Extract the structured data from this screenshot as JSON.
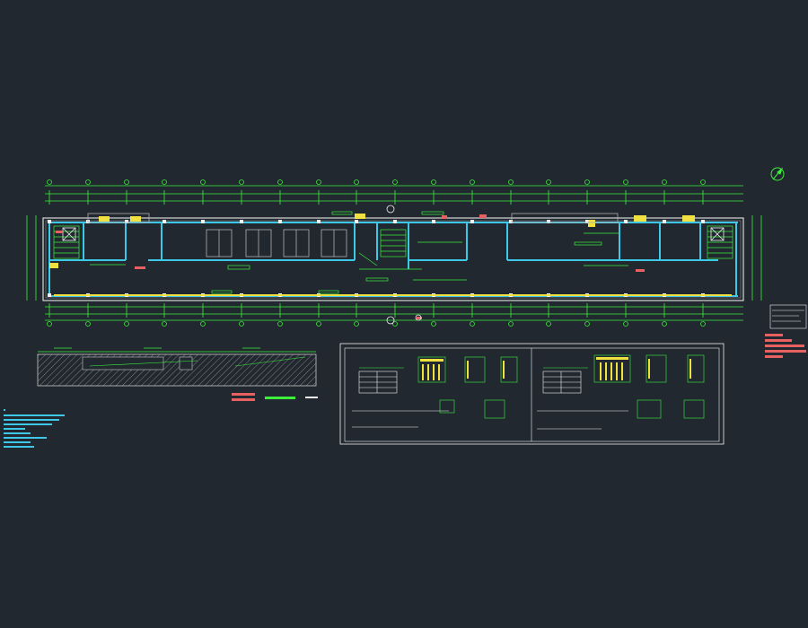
{
  "drawing": {
    "title": "",
    "colors": {
      "background": "#212830",
      "green": "#3cf03c",
      "cyan": "#3cc8e6",
      "white": "#f0f0f0",
      "yellow": "#f0e040",
      "red": "#e86060",
      "magenta": "#e040e0",
      "grey": "#a0a0a0"
    },
    "icons": {
      "north_arrow": "north-arrow-icon"
    }
  }
}
